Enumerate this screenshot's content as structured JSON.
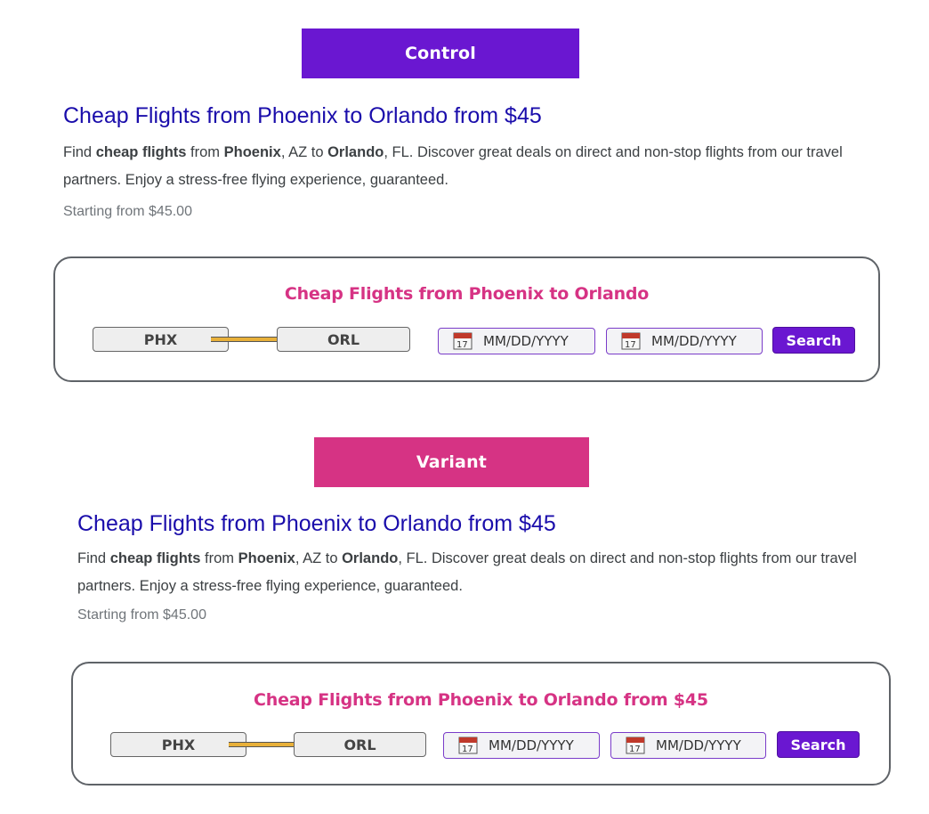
{
  "control": {
    "label": "Control",
    "label_color": "#6a17d1",
    "ad": {
      "title": "Cheap Flights from Phoenix to Orlando from $45",
      "desc_find": "Find ",
      "desc_bold1": "cheap flights",
      "desc_from": " from ",
      "desc_bold2": "Phoenix",
      "desc_az": ", AZ to ",
      "desc_bold3": "Orlando",
      "desc_rest": ", FL. Discover great deals on direct and non-stop flights from our travel partners. Enjoy a stress-free flying experience, guaranteed.",
      "price": "Starting from $45.00"
    },
    "widget": {
      "title": "Cheap Flights from Phoenix to Orlando",
      "origin": "PHX",
      "destination": "ORL",
      "depart_date": "MM/DD/YYYY",
      "return_date": "MM/DD/YYYY",
      "search_label": "Search"
    }
  },
  "variant": {
    "label": "Variant",
    "label_color": "#d63384",
    "ad": {
      "title": "Cheap Flights from Phoenix to Orlando from $45",
      "desc_find": "Find ",
      "desc_bold1": "cheap flights",
      "desc_from": " from ",
      "desc_bold2": "Phoenix",
      "desc_az": ", AZ to ",
      "desc_bold3": "Orlando",
      "desc_rest": ", FL. Discover great deals on direct and non-stop flights from our travel partners. Enjoy a stress-free flying experience, guaranteed.",
      "price": "Starting from $45.00"
    },
    "widget": {
      "title": "Cheap Flights from Phoenix to Orlando from $45",
      "origin": "PHX",
      "destination": "ORL",
      "depart_date": "MM/DD/YYYY",
      "return_date": "MM/DD/YYYY",
      "search_label": "Search"
    }
  },
  "icons": {
    "calendar": "calendar-icon",
    "arrow": "arrow-right-icon"
  },
  "colors": {
    "ad_title": "#1a0dab",
    "widget_title": "#d63384",
    "date_border": "#7a3cc9",
    "search_bg": "#6a17d1",
    "arrow": "#e8b03a"
  }
}
